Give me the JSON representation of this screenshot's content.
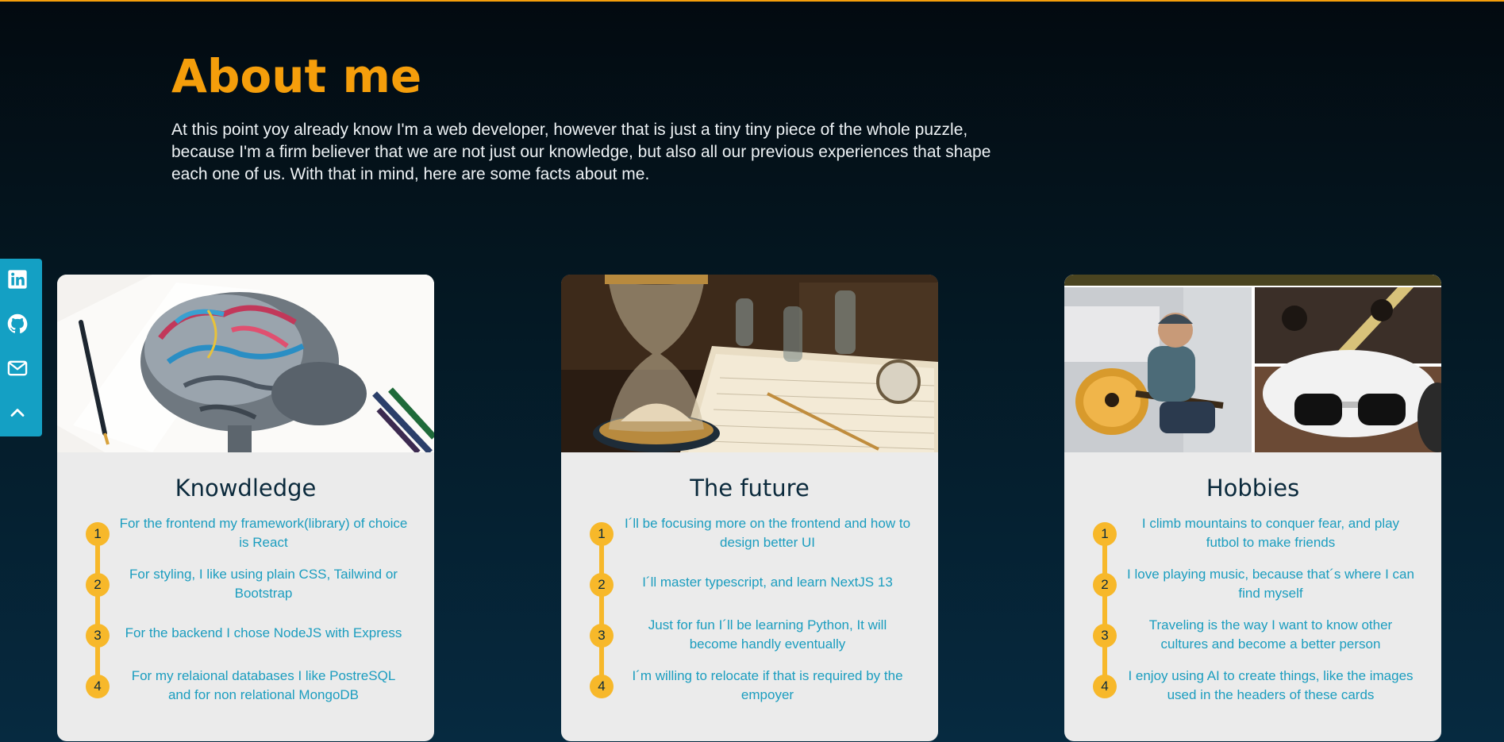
{
  "about": {
    "title": "About me",
    "intro": "At this point yoy already know I'm a web developer, however that is just a tiny tiny piece of the whole puzzle, because I'm a firm believer that we are not just our knowledge, but also all our previous experiences that shape each one of us. With that in mind, here are some facts about me."
  },
  "social": {
    "items": [
      {
        "icon": "linkedin-icon"
      },
      {
        "icon": "github-icon"
      },
      {
        "icon": "mail-icon"
      },
      {
        "icon": "chevron-up-icon"
      }
    ]
  },
  "colors": {
    "accent": "#f59e0b",
    "timeline": "#f7b82a",
    "item_text": "#1b9dbf",
    "card_title": "#0b2a3c",
    "social_bar": "#14a0c4"
  },
  "cards": [
    {
      "title": "Knowdledge",
      "image": "brain-illustration",
      "items": [
        {
          "num": "1",
          "text": "For the frontend my framework(library) of choice is React"
        },
        {
          "num": "2",
          "text": "For styling, I like using plain CSS, Tailwind or Bootstrap"
        },
        {
          "num": "3",
          "text": "For the backend I chose NodeJS with Express"
        },
        {
          "num": "4",
          "text": "For my relaional databases I like PostreSQL and for non relational MongoDB"
        }
      ]
    },
    {
      "title": "The future",
      "image": "hourglass-illustration",
      "items": [
        {
          "num": "1",
          "text": "I´ll be focusing more on the frontend and how to design better UI"
        },
        {
          "num": "2",
          "text": "I´ll master typescript, and learn NextJS 13"
        },
        {
          "num": "3",
          "text": "Just for fun I´ll be learning Python, It will become handly eventually"
        },
        {
          "num": "4",
          "text": "I´m willing to relocate if that is required by the empoyer"
        }
      ]
    },
    {
      "title": "Hobbies",
      "image": "hobbies-collage",
      "items": [
        {
          "num": "1",
          "text": "I climb mountains to conquer fear, and play futbol to make friends"
        },
        {
          "num": "2",
          "text": "I love playing music, because that´s where I can find myself"
        },
        {
          "num": "3",
          "text": "Traveling is the way I want to know other cultures and become a better person"
        },
        {
          "num": "4",
          "text": "I enjoy using AI to create things, like the images used in the headers of these cards"
        }
      ]
    }
  ]
}
